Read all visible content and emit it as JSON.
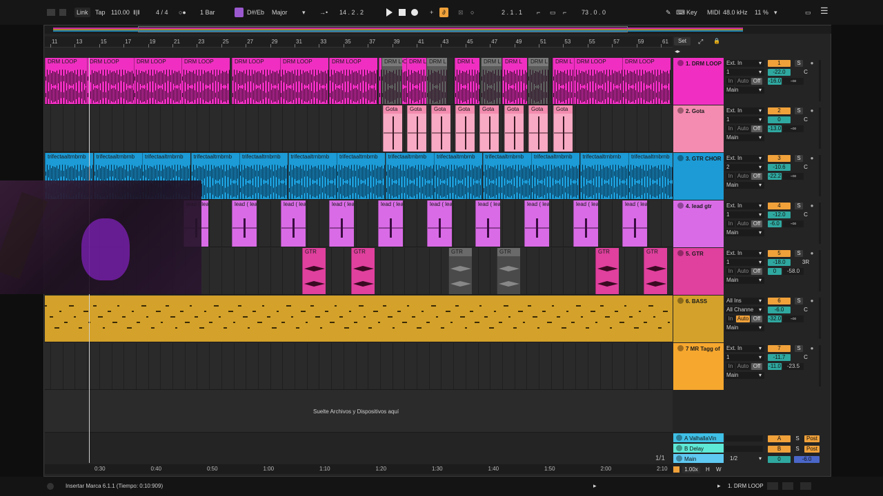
{
  "toolbar": {
    "link": "Link",
    "tap": "Tap",
    "tempo": "110.00",
    "meter_icon": "metronome-bars-icon",
    "time_sig": "4 / 4",
    "follow": "1 Bar",
    "scale_root": "D#/Eb",
    "scale_mode": "Major",
    "arrangement_position": "14 .  2 .  2",
    "loop_start": "2 .  1 .  1",
    "loop_length": "73 .  0 .  0",
    "key": "Key",
    "midi": "MIDI",
    "sample_rate": "48.0 kHz",
    "cpu": "11 %"
  },
  "ruler": {
    "bars": [
      "11",
      "13",
      "15",
      "17",
      "19",
      "21",
      "23",
      "25",
      "27",
      "29",
      "31",
      "33",
      "35",
      "37",
      "39",
      "41",
      "43",
      "45",
      "47",
      "49",
      "51",
      "53",
      "55",
      "57",
      "59",
      "61"
    ],
    "set_label": "Set"
  },
  "tracks": [
    {
      "id": 1,
      "name": "1. DRM LOOP",
      "color": "#f02fc2",
      "input": "Ext. In",
      "channel": "1",
      "monitor": [
        "In",
        "Auto",
        "Off"
      ],
      "output": "Main",
      "number": "1",
      "volume": "-22.0",
      "pan": "C",
      "send_a": "-16.0",
      "send_b": "-∞"
    },
    {
      "id": 2,
      "name": "2. Gota",
      "color": "#f38cb0",
      "input": "Ext. In",
      "channel": "1",
      "monitor": [
        "In",
        "Auto",
        "Off"
      ],
      "output": "Main",
      "number": "2",
      "volume": "0",
      "pan": "C",
      "send_a": "-13.0",
      "send_b": "-∞"
    },
    {
      "id": 3,
      "name": "3. GTR CHOR",
      "color": "#1c9bd6",
      "input": "Ext. In",
      "channel": "2",
      "monitor": [
        "In",
        "Auto",
        "Off"
      ],
      "output": "Main",
      "number": "3",
      "volume": "-10.6",
      "pan": "C",
      "send_a": "-22.2",
      "send_b": "-∞"
    },
    {
      "id": 4,
      "name": "4. lead gtr",
      "color": "#d96ce6",
      "input": "Ext. In",
      "channel": "1",
      "monitor": [
        "In",
        "Auto",
        "Off"
      ],
      "output": "Main",
      "number": "4",
      "volume": "-12.0",
      "pan": "C",
      "send_a": "-6.0",
      "send_b": "-∞"
    },
    {
      "id": 5,
      "name": "5. GTR",
      "color": "#e0409e",
      "input": "Ext. In",
      "channel": "1",
      "monitor": [
        "In",
        "Auto",
        "Off"
      ],
      "output": "Main",
      "number": "5",
      "volume": "-18.0",
      "pan": "3R",
      "send_a": "0",
      "send_b": "-58.0"
    },
    {
      "id": 6,
      "name": "6. BASS",
      "color": "#d4a22a",
      "input": "All Ins",
      "channel": "All Channe",
      "monitor": [
        "In",
        "Auto",
        "Off"
      ],
      "output": "Main",
      "number": "6",
      "volume": "-6.0",
      "pan": "C",
      "send_a": "-32.0",
      "send_b": "-∞"
    },
    {
      "id": 7,
      "name": "7 MR Tagg of",
      "color": "#f6a72e",
      "input": "Ext. In",
      "channel": "1",
      "monitor": [
        "In",
        "Auto",
        "Off"
      ],
      "output": "Main",
      "number": "7",
      "volume": "-11.7",
      "pan": "C",
      "send_a": "-11.0",
      "send_b": "-23.5"
    }
  ],
  "clips": {
    "drm_loop": "DRM LOOP",
    "drm_short": "DRM L",
    "gota": "Gota",
    "gtr_chor": "trifectaaltrnbrnb",
    "lead": "lead",
    "lead_short": "lead ( lea",
    "gtr": "GTR"
  },
  "drop_hint": "Suelte Archivos y Dispositivos aquí",
  "returns": [
    {
      "name": "A ValhallaVin",
      "color": "#3fc0e6",
      "send": "A",
      "s": "S",
      "post": "Post"
    },
    {
      "name": "B Delay",
      "color": "#5ee8d6",
      "send": "B",
      "s": "S",
      "post": "Post"
    }
  ],
  "main": {
    "name": "Main",
    "color": "#5fc9f2",
    "routing": "1/2",
    "volume": "0",
    "pan": "-6.0"
  },
  "page_indicator": "1/1",
  "zoom": "1.00x",
  "time_labels": [
    "0:30",
    "0:40",
    "0:50",
    "1:00",
    "1:10",
    "1:20",
    "1:30",
    "1:40",
    "1:50",
    "2:00",
    "2:10"
  ],
  "status": {
    "message": "Insertar Marca 6.1.1 (Tiempo: 0:10:909)",
    "selected_track": "1. DRM LOOP"
  }
}
